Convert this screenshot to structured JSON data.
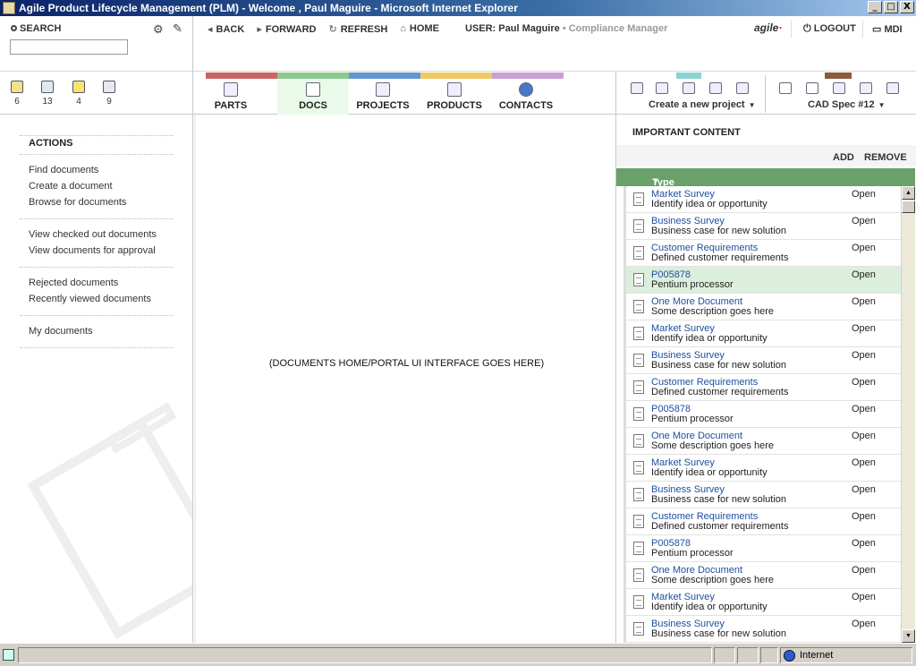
{
  "window": {
    "title": "Agile Product Lifecycle Management (PLM) - Welcome , Paul Maguire - Microsoft Internet Explorer",
    "minimize": "_",
    "maximize": "□",
    "close": "X"
  },
  "search": {
    "label": "SEARCH",
    "value": "",
    "placeholder": ""
  },
  "topnav": {
    "back": "BACK",
    "forward": "FORWARD",
    "refresh": "REFRESH",
    "home": "HOME",
    "user_prefix": "USER:",
    "user_name": "Paul Maguire",
    "user_role": "• Compliance Manager",
    "logo": "agile",
    "logout": "LOGOUT",
    "mdi": "MDI"
  },
  "counts": [
    "6",
    "13",
    "4",
    "9"
  ],
  "modules": [
    {
      "label": "PARTS",
      "color": "#c86464",
      "icon": "parts-icon"
    },
    {
      "label": "DOCS",
      "color": "#8cc88c",
      "icon": "docs-icon"
    },
    {
      "label": "PROJECTS",
      "color": "#6496d2",
      "icon": "projects-icon"
    },
    {
      "label": "PRODUCTS",
      "color": "#f0c864",
      "icon": "products-icon"
    },
    {
      "label": "CONTACTS",
      "color": "#c8a0d2",
      "icon": "contacts-icon"
    }
  ],
  "tools": {
    "project_dropdown": "Create a new project",
    "cad_dropdown": "CAD Spec #12",
    "project_accent": "#8cd2d2",
    "cad_accent": "#8c5a3c"
  },
  "sidebar": {
    "heading": "ACTIONS",
    "links": [
      "Find documents",
      "Create a document",
      "Browse for documents",
      "View checked out documents",
      "View documents for approval",
      "Rejected documents",
      "Recently viewed documents",
      "My documents"
    ]
  },
  "center": {
    "message": "(DOCUMENTS HOME/PORTAL UI INTERFACE GOES HERE)"
  },
  "important": {
    "title": "IMPORTANT CONTENT",
    "add": "ADD",
    "remove": "REMOVE",
    "column": "Type",
    "rows": [
      {
        "title": "Market Survey",
        "desc": "Identify idea or opportunity",
        "status": "Open"
      },
      {
        "title": "Business Survey",
        "desc": "Business case for new solution",
        "status": "Open"
      },
      {
        "title": "Customer Requirements",
        "desc": "Defined customer requirements",
        "status": "Open"
      },
      {
        "title": "P005878",
        "desc": "Pentium processor",
        "status": "Open",
        "highlight": true
      },
      {
        "title": "One More Document",
        "desc": "Some description goes here",
        "status": "Open"
      },
      {
        "title": "Market Survey",
        "desc": "Identify idea or opportunity",
        "status": "Open"
      },
      {
        "title": "Business Survey",
        "desc": "Business case for new solution",
        "status": "Open"
      },
      {
        "title": "Customer Requirements",
        "desc": "Defined customer requirements",
        "status": "Open"
      },
      {
        "title": "P005878",
        "desc": "Pentium processor",
        "status": "Open"
      },
      {
        "title": "One More Document",
        "desc": "Some description goes here",
        "status": "Open"
      },
      {
        "title": "Market Survey",
        "desc": "Identify idea or opportunity",
        "status": "Open"
      },
      {
        "title": "Business Survey",
        "desc": "Business case for new solution",
        "status": "Open"
      },
      {
        "title": "Customer Requirements",
        "desc": "Defined customer requirements",
        "status": "Open"
      },
      {
        "title": "P005878",
        "desc": "Pentium processor",
        "status": "Open"
      },
      {
        "title": "One More Document",
        "desc": "Some description goes here",
        "status": "Open"
      },
      {
        "title": "Market Survey",
        "desc": "Identify idea or opportunity",
        "status": "Open"
      },
      {
        "title": "Business Survey",
        "desc": "Business case for new solution",
        "status": "Open"
      }
    ]
  },
  "statusbar": {
    "zone": "Internet"
  }
}
